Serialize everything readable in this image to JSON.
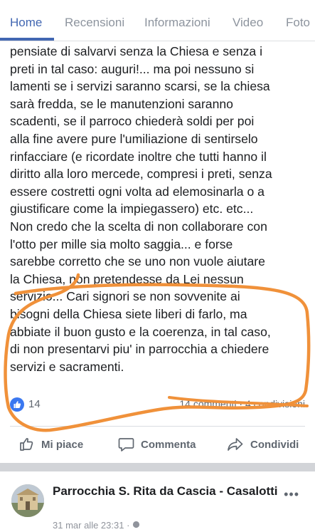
{
  "tabs": [
    {
      "label": "Home",
      "active": true
    },
    {
      "label": "Recensioni",
      "active": false
    },
    {
      "label": "Informazioni",
      "active": false
    },
    {
      "label": "Video",
      "active": false
    },
    {
      "label": "Foto",
      "active": false
    }
  ],
  "post": {
    "lines": [
      "pensiate di salvarvi senza la Chiesa e senza i",
      "preti in tal caso: auguri!... ma poi nessuno si",
      "lamenti se i servizi saranno scarsi, se la chiesa",
      "sarà fredda, se le manutenzioni saranno",
      "scadenti, se il parroco chiederà soldi per poi",
      "alla fine avere pure l'umiliazione di sentirselo",
      "rinfacciare (e ricordate inoltre che tutti hanno il",
      "diritto alla loro mercede, compresi i preti, senza",
      "essere costretti ogni volta ad elemosinarla o a",
      "giustificare come la impiegassero) etc.  etc...",
      "Non credo che la scelta di non collaborare con",
      "l'otto per mille sia molto saggia... e forse",
      "sarebbe corretto che se uno non vuole aiutare",
      "la Chiesa, non pretendesse da Lei nessun",
      "servizio... Cari signori se non sovvenite ai",
      "bisogni della Chiesa siete liberi di farlo, ma",
      "abbiate il buon gusto e la coerenza, in tal caso,",
      "di non presentarvi piu' in parrocchia a chiedere",
      "servizi e sacramenti."
    ],
    "reaction_count": "14",
    "stats_right": "14 commenti · 4 condivisioni",
    "annotation_color": "#f0913a"
  },
  "actions": {
    "like": "Mi piace",
    "comment": "Commenta",
    "share": "Condividi"
  },
  "next_post": {
    "page_name": "Parrocchia S. Rita da Cascia - Casalotti",
    "date": "31 mar alle 23:31 · ",
    "more": "•••"
  },
  "colors": {
    "accent": "#4267b2",
    "like_blue": "#3b78f0",
    "muted": "#606770"
  }
}
